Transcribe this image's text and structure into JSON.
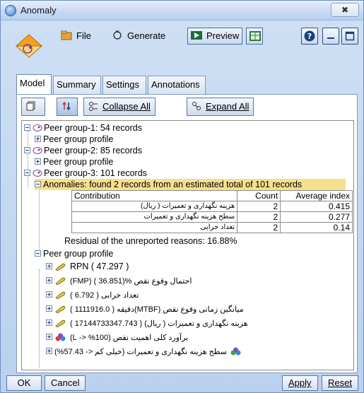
{
  "window": {
    "title": "Anomaly",
    "close_glyph": "✖"
  },
  "toolbar": {
    "file_label": "File",
    "generate_label": "Generate",
    "preview_label": "Preview",
    "help_glyph": "?"
  },
  "tabs": [
    {
      "label": "Model",
      "active": true
    },
    {
      "label": "Summary",
      "active": false
    },
    {
      "label": "Settings",
      "active": false
    },
    {
      "label": "Annotations",
      "active": false
    }
  ],
  "subtoolbar": {
    "collapse_label": "Collapse All",
    "expand_label": "Expand All"
  },
  "tree": {
    "groups": [
      {
        "label": "Peer group-1: 54 records",
        "profile": "Peer group profile"
      },
      {
        "label": "Peer group-2: 85 records",
        "profile": "Peer group profile"
      },
      {
        "label": "Peer group-3: 101 records"
      }
    ],
    "anomalies": "Anomalies: found 2 records from an estimated total of 101 records",
    "contribution_table": {
      "headers": [
        "Contribution",
        "Count",
        "Average index"
      ],
      "rows": [
        [
          "هزینه نگهداری و تعمیرات ( ریال)",
          "2",
          "0.415"
        ],
        [
          "سطح هزینه نگهداری و تعمیرات",
          "2",
          "0.277"
        ],
        [
          "تعداد خرابی",
          "2",
          "0.14"
        ]
      ]
    },
    "residual": "Residual of the unreported reasons: 16.88%",
    "profile3": "Peer group profile",
    "profile_items": [
      {
        "text": "RPN ( 47.297 )",
        "icon": "wrench-icon"
      },
      {
        "text": "احتمال وقوع نقص %(36.851 ) (FMP)",
        "icon": "wrench-icon"
      },
      {
        "text": "تعداد خرابی ( 6.792 )",
        "icon": "wrench-icon"
      },
      {
        "text": "میانگین زمانی وقوع نقص (MTBF)دقیقه ( 1111916.0 )",
        "icon": "wrench-icon"
      },
      {
        "text": "هزینه نگهداری و تعمیرات ( ریال) ( 17144733347.743 )",
        "icon": "wrench-icon"
      },
      {
        "text": "برآورد کلی اهمیت نقص (100% <- L)",
        "icon": "balls-icon"
      },
      {
        "text": "سطح هزینه نگهداری و تعمیرات (خیلی کم <- 57.43%)",
        "icon": "balls-icon"
      }
    ]
  },
  "buttons": {
    "ok": "OK",
    "cancel": "Cancel",
    "apply": "Apply",
    "reset": "Reset"
  },
  "colors": {
    "accent": "#4a7fc7",
    "highlight": "#f7e08d",
    "tab_active_text": "#000000"
  }
}
